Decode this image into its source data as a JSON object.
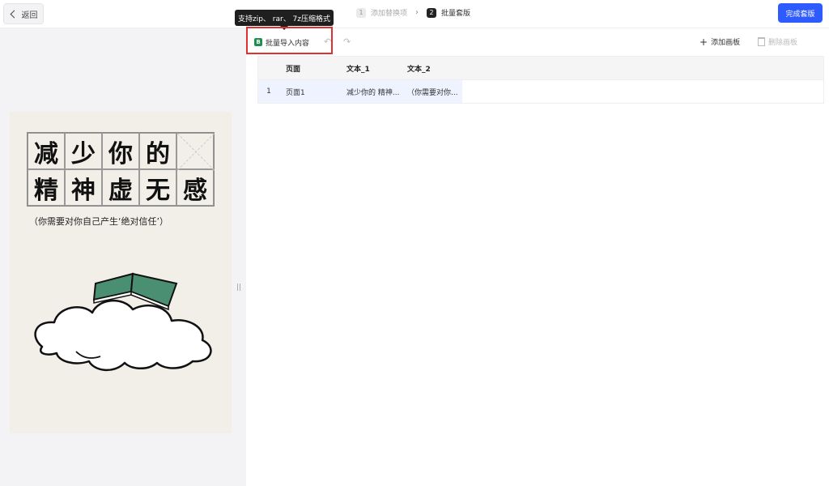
{
  "topbar": {
    "back_label": "返回",
    "steps": [
      {
        "num": "1",
        "label": "添加替换项"
      },
      {
        "num": "2",
        "label": "批量套版"
      }
    ],
    "finish_label": "完成套版"
  },
  "poster": {
    "grid_chars": [
      "减",
      "少",
      "你",
      "的",
      "",
      "精",
      "神",
      "虚",
      "无",
      "感"
    ],
    "subtitle": "（你需要对你自己产生‘绝对信任’）"
  },
  "editor": {
    "tooltip": "支持zip、 rar、 7z压缩格式",
    "import_label": "批量导入内容",
    "import_icon": "B",
    "add_board_label": "添加画板",
    "delete_board_label": "删除画板"
  },
  "table": {
    "headers": [
      "",
      "页面",
      "文本_1",
      "文本_2"
    ],
    "rows": [
      [
        "1",
        "页面1",
        "减少你的 精神...",
        "（你需要对你..."
      ]
    ]
  },
  "colors": {
    "primary": "#2e5bff",
    "highlight": "#e03030",
    "book_green": "#4b8f73"
  }
}
